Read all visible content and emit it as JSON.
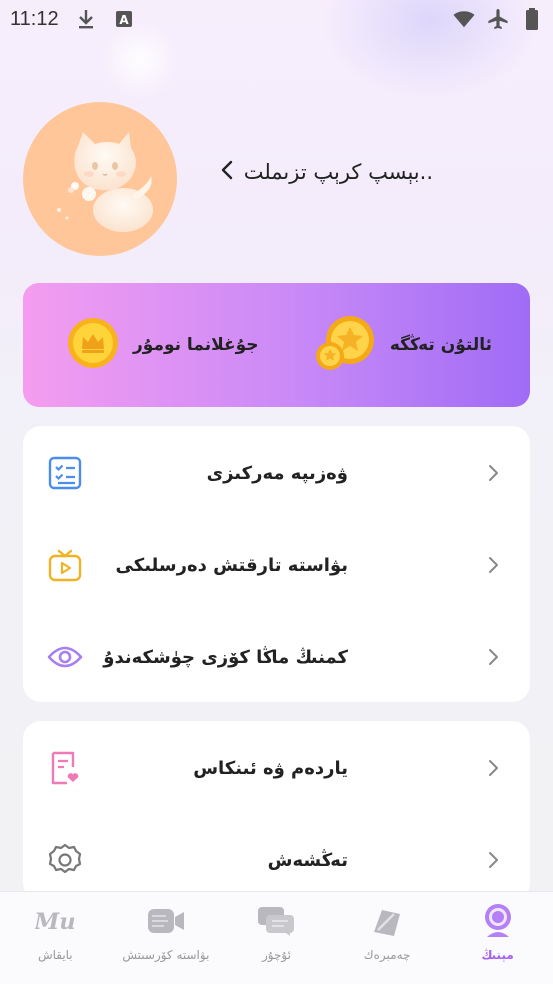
{
  "status_bar": {
    "time": "11:12",
    "icons": [
      "download-icon",
      "text-a-icon",
      "wifi-icon",
      "airplane-icon",
      "battery-icon"
    ]
  },
  "profile": {
    "name": "بېسپ كرېپ تزىملت..",
    "avatar": "cat-avatar"
  },
  "banner": {
    "right_label": "ئالتۇن تەڭگە",
    "left_label": "جۇغلانما نومۇر"
  },
  "menu_card1": [
    {
      "label": "ۋەزىپە مەركىزى",
      "icon": "task-list-icon"
    },
    {
      "label": "بۋاسته تارقتش دەرسلىكى",
      "icon": "tv-play-icon"
    },
    {
      "label": "كمنىڭ ماڭا كۆزى چۈشكەندۇ",
      "icon": "eye-icon"
    }
  ],
  "menu_card2": [
    {
      "label": "ياردەم ۋە ئىنكاس",
      "icon": "help-heart-icon"
    },
    {
      "label": "تەڭشەش",
      "icon": "gear-icon"
    }
  ],
  "bottom_nav": [
    {
      "label": "بايقاش",
      "icon": "mu-logo-icon",
      "active": false
    },
    {
      "label": "بۋاسته كۆرسىتش",
      "icon": "video-camera-icon",
      "active": false
    },
    {
      "label": "ئۇچۇر",
      "icon": "chat-bubbles-icon",
      "active": false
    },
    {
      "label": "چەمبرەك",
      "icon": "compass-icon",
      "active": false
    },
    {
      "label": "مېنىڭ",
      "icon": "astronaut-icon",
      "active": true
    }
  ],
  "colors": {
    "accent": "#a45ff5",
    "banner_start": "#f49df0",
    "banner_end": "#a06cf6",
    "avatar_bg": "#ffc69a"
  }
}
